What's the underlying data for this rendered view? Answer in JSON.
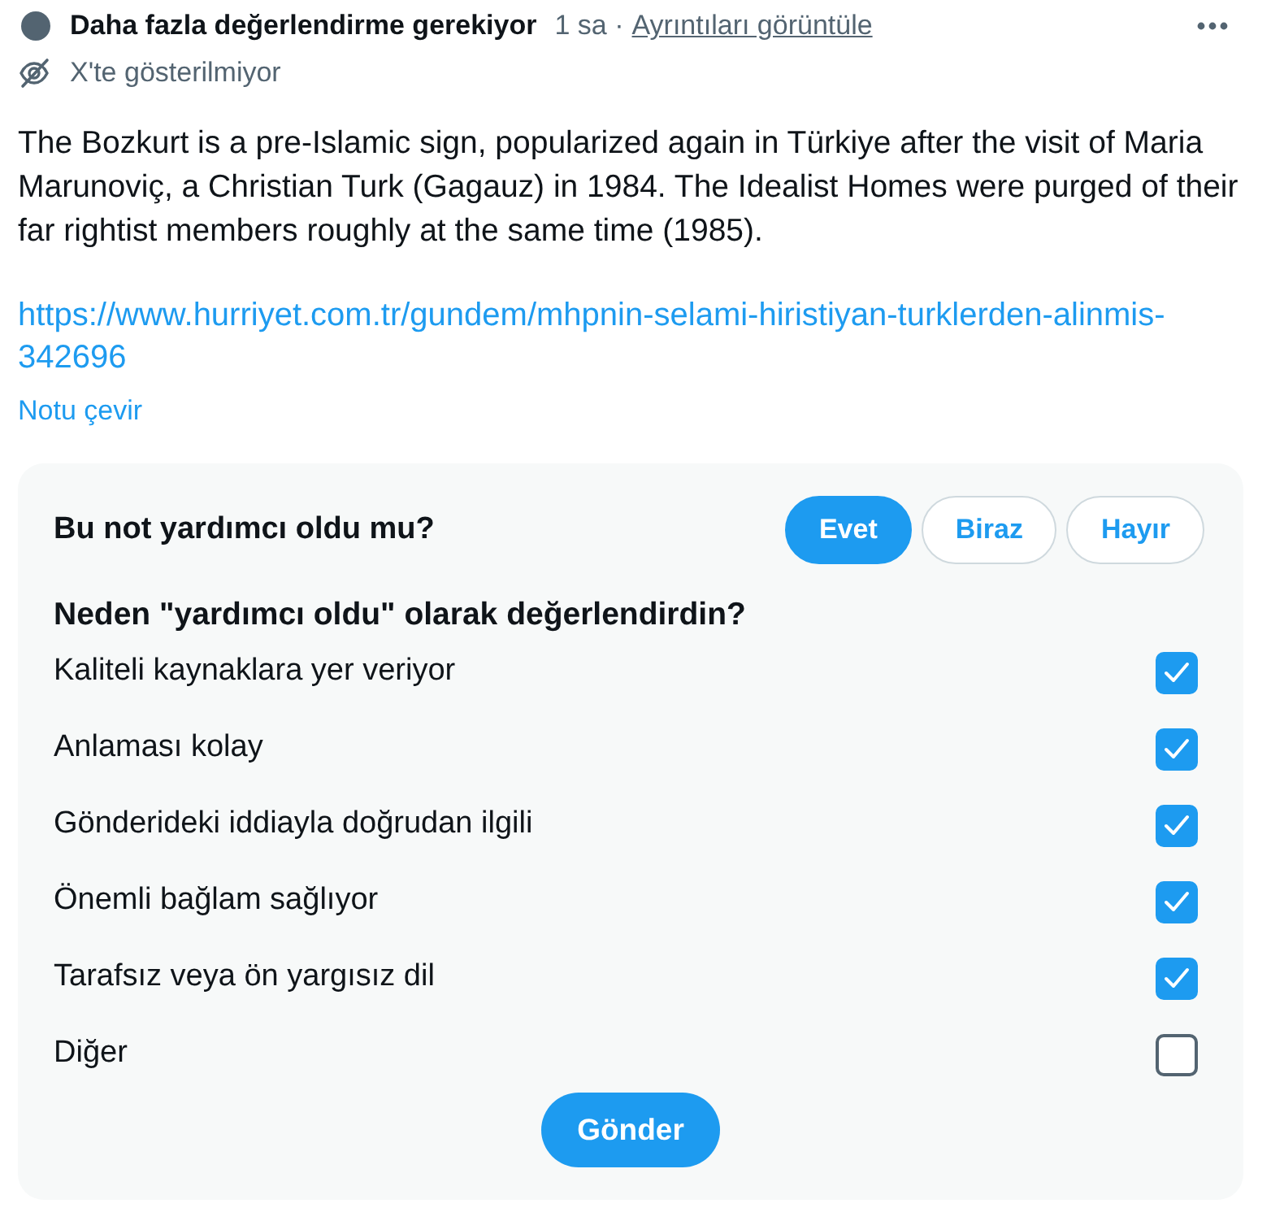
{
  "note": {
    "status": "Daha fazla değerlendirme gerekiyor",
    "time": "1 sa",
    "separator": "·",
    "details_link": "Ayrıntıları görüntüle",
    "visibility": "X'te gösterilmiyor",
    "text": "The Bozkurt is a pre-Islamic sign, popularized again in Türkiye after the visit of Maria Marunoviç, a Christian Turk (Gagauz) in 1984. The Idealist Homes were purged of their far rightist members roughly at the same time (1985).",
    "url": "https://www.hurriyet.com.tr/gundem/mhpnin-selami-hiristiyan-turklerden-alinmis-342696",
    "translate": "Notu çevir"
  },
  "rating": {
    "question": "Bu not yardımcı oldu mu?",
    "options": [
      {
        "label": "Evet",
        "selected": true
      },
      {
        "label": "Biraz",
        "selected": false
      },
      {
        "label": "Hayır",
        "selected": false
      }
    ],
    "reason_question": "Neden \"yardımcı oldu\" olarak değerlendirdin?",
    "reasons": [
      {
        "label": "Kaliteli kaynaklara yer veriyor",
        "checked": true
      },
      {
        "label": "Anlaması kolay",
        "checked": true
      },
      {
        "label": "Gönderideki iddiayla doğrudan ilgili",
        "checked": true
      },
      {
        "label": "Önemli bağlam sağlıyor",
        "checked": true
      },
      {
        "label": "Tarafsız veya ön yargısız dil",
        "checked": true
      },
      {
        "label": "Diğer",
        "checked": false
      }
    ],
    "submit": "Gönder"
  }
}
